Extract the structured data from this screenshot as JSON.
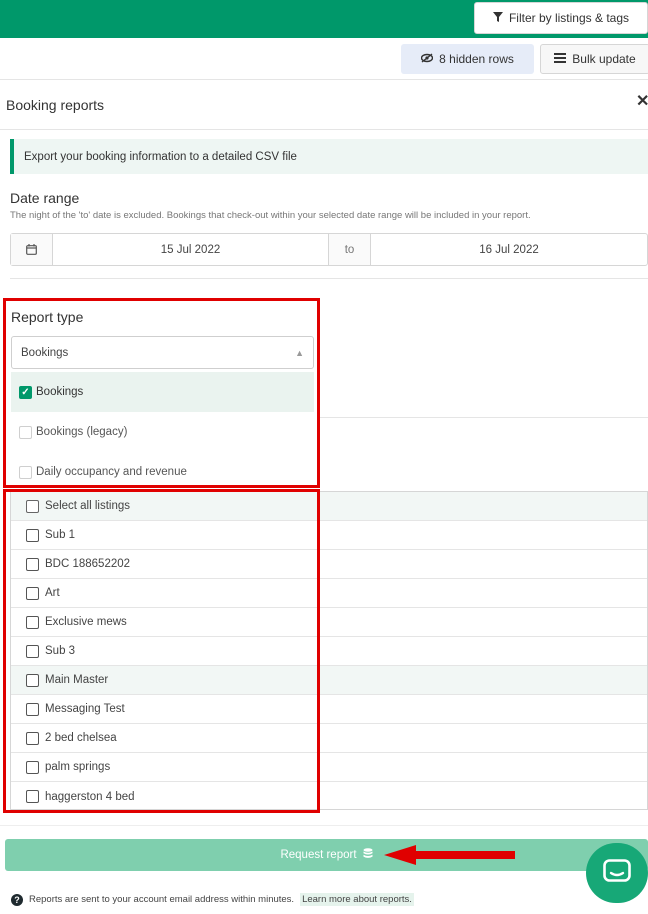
{
  "header": {
    "filter_button": "Filter by listings & tags",
    "hidden_rows_button": "8 hidden rows",
    "bulk_update_button": "Bulk update"
  },
  "modal": {
    "title": "Booking reports",
    "info_text": "Export your booking information to a detailed CSV file",
    "date_range": {
      "title": "Date range",
      "hint": "The night of the 'to' date is excluded. Bookings that check-out within your selected date range will be included in your report.",
      "from": "15 Jul 2022",
      "to_label": "to",
      "until": "16 Jul 2022"
    },
    "report_type": {
      "title": "Report type",
      "selected": "Bookings",
      "options": [
        {
          "label": "Bookings",
          "checked": true
        },
        {
          "label": "Bookings (legacy)",
          "checked": false
        },
        {
          "label": "Daily occupancy and revenue",
          "checked": false
        }
      ]
    },
    "listings": {
      "select_all": "Select all listings",
      "items": [
        "Sub 1",
        "BDC 188652202",
        "Art",
        "Exclusive mews",
        "Sub 3",
        "Main Master",
        "Messaging Test",
        "2 bed chelsea",
        "palm springs",
        "haggerston 4 bed"
      ]
    },
    "request_button": "Request report",
    "footer_note": "Reports are sent to your account email address within minutes.",
    "learn_more": "Learn more about reports."
  },
  "colors": {
    "brand_green": "#00986a",
    "button_green": "#7fcfae",
    "highlight_red": "#e00000"
  },
  "icons": [
    "filter-icon",
    "eye-slash-icon",
    "list-icon",
    "close-icon",
    "calendar-icon",
    "checkbox-icon",
    "database-icon",
    "chat-icon",
    "help-icon"
  ]
}
